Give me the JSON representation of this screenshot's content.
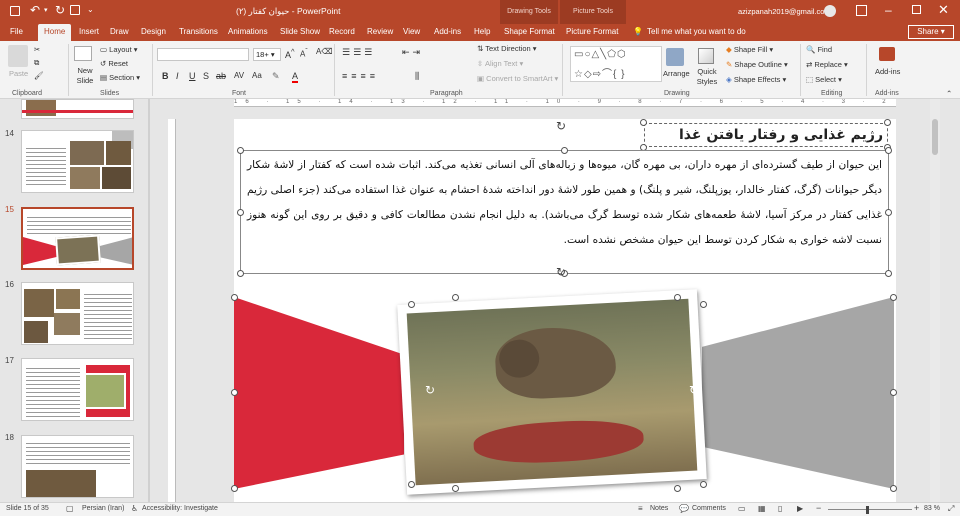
{
  "window": {
    "doc_title": "حیوان کفتار (۲)  -  PowerPoint",
    "context_drawing": "Drawing Tools",
    "context_picture": "Picture Tools",
    "user_email": "azizpanah2019@gmail.com"
  },
  "tabs": [
    {
      "label": "File"
    },
    {
      "label": "Home"
    },
    {
      "label": "Insert"
    },
    {
      "label": "Draw"
    },
    {
      "label": "Design"
    },
    {
      "label": "Transitions"
    },
    {
      "label": "Animations"
    },
    {
      "label": "Slide Show"
    },
    {
      "label": "Record"
    },
    {
      "label": "Review"
    },
    {
      "label": "View"
    },
    {
      "label": "Add-ins"
    },
    {
      "label": "Help"
    },
    {
      "label": "Shape Format"
    },
    {
      "label": "Picture Format"
    }
  ],
  "tell_me": "Tell me what you want to do",
  "share_label": "Share",
  "ribbon": {
    "paste": "Paste",
    "new_slide": "New Slide",
    "layout": "Layout",
    "reset": "Reset",
    "section": "Section",
    "font_size": "18+",
    "text_direction": "Text Direction",
    "align_text": "Align Text",
    "convert_smartart": "Convert to SmartArt",
    "arrange": "Arrange",
    "quick_styles": "Quick Styles",
    "shape_fill": "Shape Fill",
    "shape_outline": "Shape Outline",
    "shape_effects": "Shape Effects",
    "find": "Find",
    "replace": "Replace",
    "select": "Select",
    "addins": "Add-ins",
    "groups": {
      "clipboard": "Clipboard",
      "slides": "Slides",
      "font": "Font",
      "paragraph": "Paragraph",
      "drawing": "Drawing",
      "editing": "Editing",
      "addins": "Add-ins"
    }
  },
  "thumbnails": [
    {
      "num": "14"
    },
    {
      "num": "15"
    },
    {
      "num": "16"
    },
    {
      "num": "17"
    },
    {
      "num": "18"
    }
  ],
  "slide": {
    "title": "رژیم غذایی و رفتار یافتن غذا",
    "body": "این حیوان از طیف گسترده‌ای از مهره داران، بی مهره گان، میوه‌ها و زباله‌های آلی انسانی تغذیه می‌کند. اثبات شده است که کفتار از لاشهٔ شکار دیگر حیوانات (گرگ، کفتار خالدار، یوزپلنگ، شیر و پلنگ) و همین طور لاشهٔ دور انداخته شدهٔ احشام به عنوان غذا استفاده می‌کند (جزء اصلی رژیم غذایی کفتار در مرکز آسیا، لاشهٔ طعمه‌های شکار شده توسط گرگ می‌باشد). به دلیل انجام نشدن مطالعات کافی و دقیق بر روی این گونه هنوز نسبت لاشه خواری به شکار کردن توسط این حیوان مشخص نشده است."
  },
  "status": {
    "slide_of": "Slide 15 of 35",
    "language": "Persian (Iran)",
    "accessibility": "Accessibility: Investigate",
    "notes": "Notes",
    "comments": "Comments",
    "zoom": "83 %"
  },
  "colors": {
    "accent": "#b7472a",
    "slide_red": "#d9283a",
    "slide_gray": "#a6a6a6"
  }
}
